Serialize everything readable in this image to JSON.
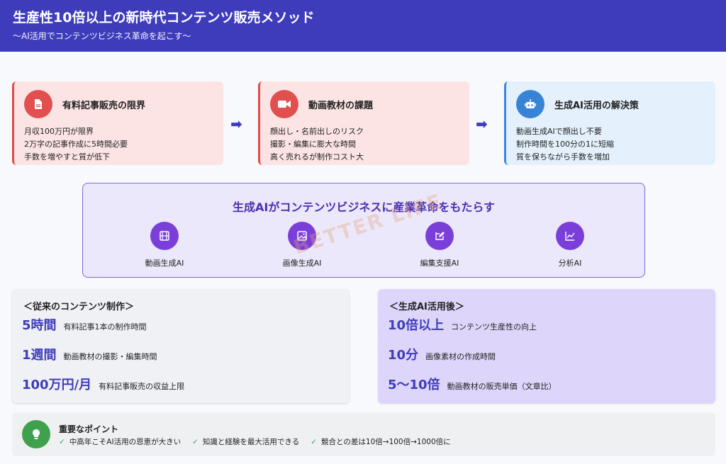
{
  "header": {
    "title": "生産性10倍以上の新時代コンテンツ販売メソッド",
    "subtitle": "〜AI活用でコンテンツビジネス革命を起こす〜"
  },
  "cards": [
    {
      "title": "有料記事販売の限界",
      "icon": "document-icon",
      "lines": [
        "月収100万円が限界",
        "2万字の記事作成に5時間必要",
        "手数を増やすと質が低下"
      ]
    },
    {
      "title": "動画教材の課題",
      "icon": "video-camera-icon",
      "lines": [
        "顔出し・名前出しのリスク",
        "撮影・編集に膨大な時間",
        "高く売れるが制作コスト大"
      ]
    },
    {
      "title": "生成AI活用の解決策",
      "icon": "robot-icon",
      "lines": [
        "動画生成AIで顔出し不要",
        "制作時間を100分の1に短縮",
        "質を保ちながら手数を増加"
      ]
    }
  ],
  "arrow_glyph": "➡",
  "ai_panel": {
    "title": "生成AIがコンテンツビジネスに産業革命をもたらす",
    "tools": [
      {
        "label": "動画生成AI",
        "icon": "film-icon"
      },
      {
        "label": "画像生成AI",
        "icon": "image-icon"
      },
      {
        "label": "編集支援AI",
        "icon": "edit-icon"
      },
      {
        "label": "分析AI",
        "icon": "chart-icon"
      }
    ]
  },
  "watermark": "BETTER LIFE",
  "before": {
    "title": "＜従来のコンテンツ制作＞",
    "stats": [
      {
        "value": "5時間",
        "desc": "有料記事1本の制作時間"
      },
      {
        "value": "1週間",
        "desc": "動画教材の撮影・編集時間"
      },
      {
        "value": "100万円/月",
        "desc": "有料記事販売の収益上限"
      }
    ]
  },
  "after": {
    "title": "＜生成AI活用後＞",
    "stats": [
      {
        "value": "10倍以上",
        "desc": "コンテンツ生産性の向上"
      },
      {
        "value": "10分",
        "desc": "画像素材の作成時間"
      },
      {
        "value": "5〜10倍",
        "desc": "動画教材の販売単価（文章比）"
      }
    ]
  },
  "point": {
    "title": "重要なポイント",
    "icon": "lightbulb-icon",
    "check_glyph": "✓",
    "items": [
      "中高年こそAI活用の恩恵が大きい",
      "知識と経験を最大活用できる",
      "競合との差は10倍→100倍→1000倍に"
    ]
  },
  "colors": {
    "header": "#3f3cbc",
    "accent_purple": "#7b3fd9",
    "red": "#e14f4f",
    "blue": "#3784d6",
    "green": "#3fa14c"
  }
}
